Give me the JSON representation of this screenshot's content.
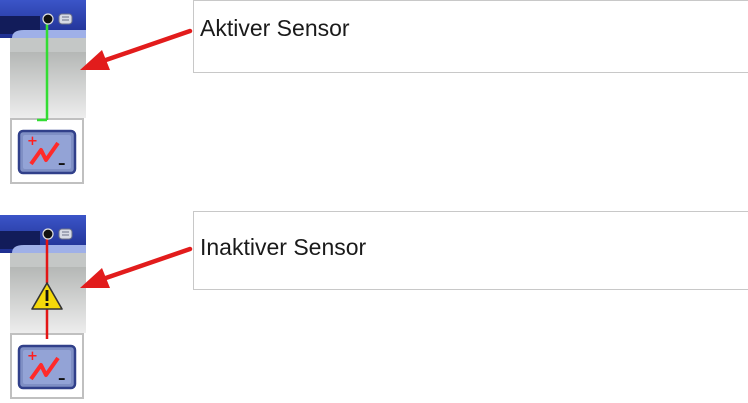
{
  "sensors": [
    {
      "label": "Aktiver Sensor",
      "status": "active",
      "line_color": "#33dd33"
    },
    {
      "label": "Inaktiver Sensor",
      "status": "inactive",
      "line_color": "#e31515"
    }
  ],
  "colors": {
    "arrow": "#e21c1c",
    "toolbar_blue": "#2a3fa8",
    "battery_button": "#7f8fc4"
  },
  "icons": {
    "active": [
      "sensor-jack-icon",
      "usb-icon",
      "battery-icon"
    ],
    "inactive": [
      "sensor-jack-icon",
      "usb-icon",
      "warning-icon",
      "battery-icon"
    ]
  }
}
